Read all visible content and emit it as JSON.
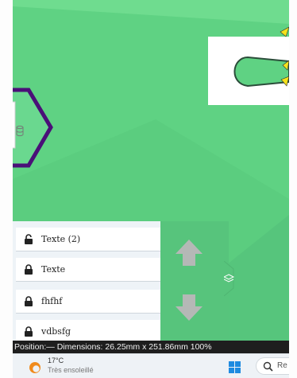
{
  "layers": [
    {
      "label": "Texte (2)"
    },
    {
      "label": "Texte"
    },
    {
      "label": "fhfhf"
    },
    {
      "label": "vdbsfg"
    }
  ],
  "status": {
    "text": "Position:— Dimensions: 26.25mm x 251.86mm 100%"
  },
  "taskbar": {
    "temperature": "17°C",
    "weather": "Très ensoleillé",
    "search_text": "Re"
  },
  "colors": {
    "canvas_green": "#5fd283",
    "shape_purple": "#4a1078",
    "arrow_gray": "#b5b8b6",
    "panel_green": "#57c47c",
    "status_bar": "#1e1e1e",
    "accent_yellow": "#f5e21b"
  },
  "icons": {
    "layer_lock": "lock-icon",
    "layer_tab": "layers-icon",
    "move_up": "arrow-up-icon",
    "move_down": "arrow-down-icon",
    "shape_handle": "database-icon",
    "start": "windows-start-icon",
    "search": "search-icon",
    "weather": "sun-icon"
  }
}
